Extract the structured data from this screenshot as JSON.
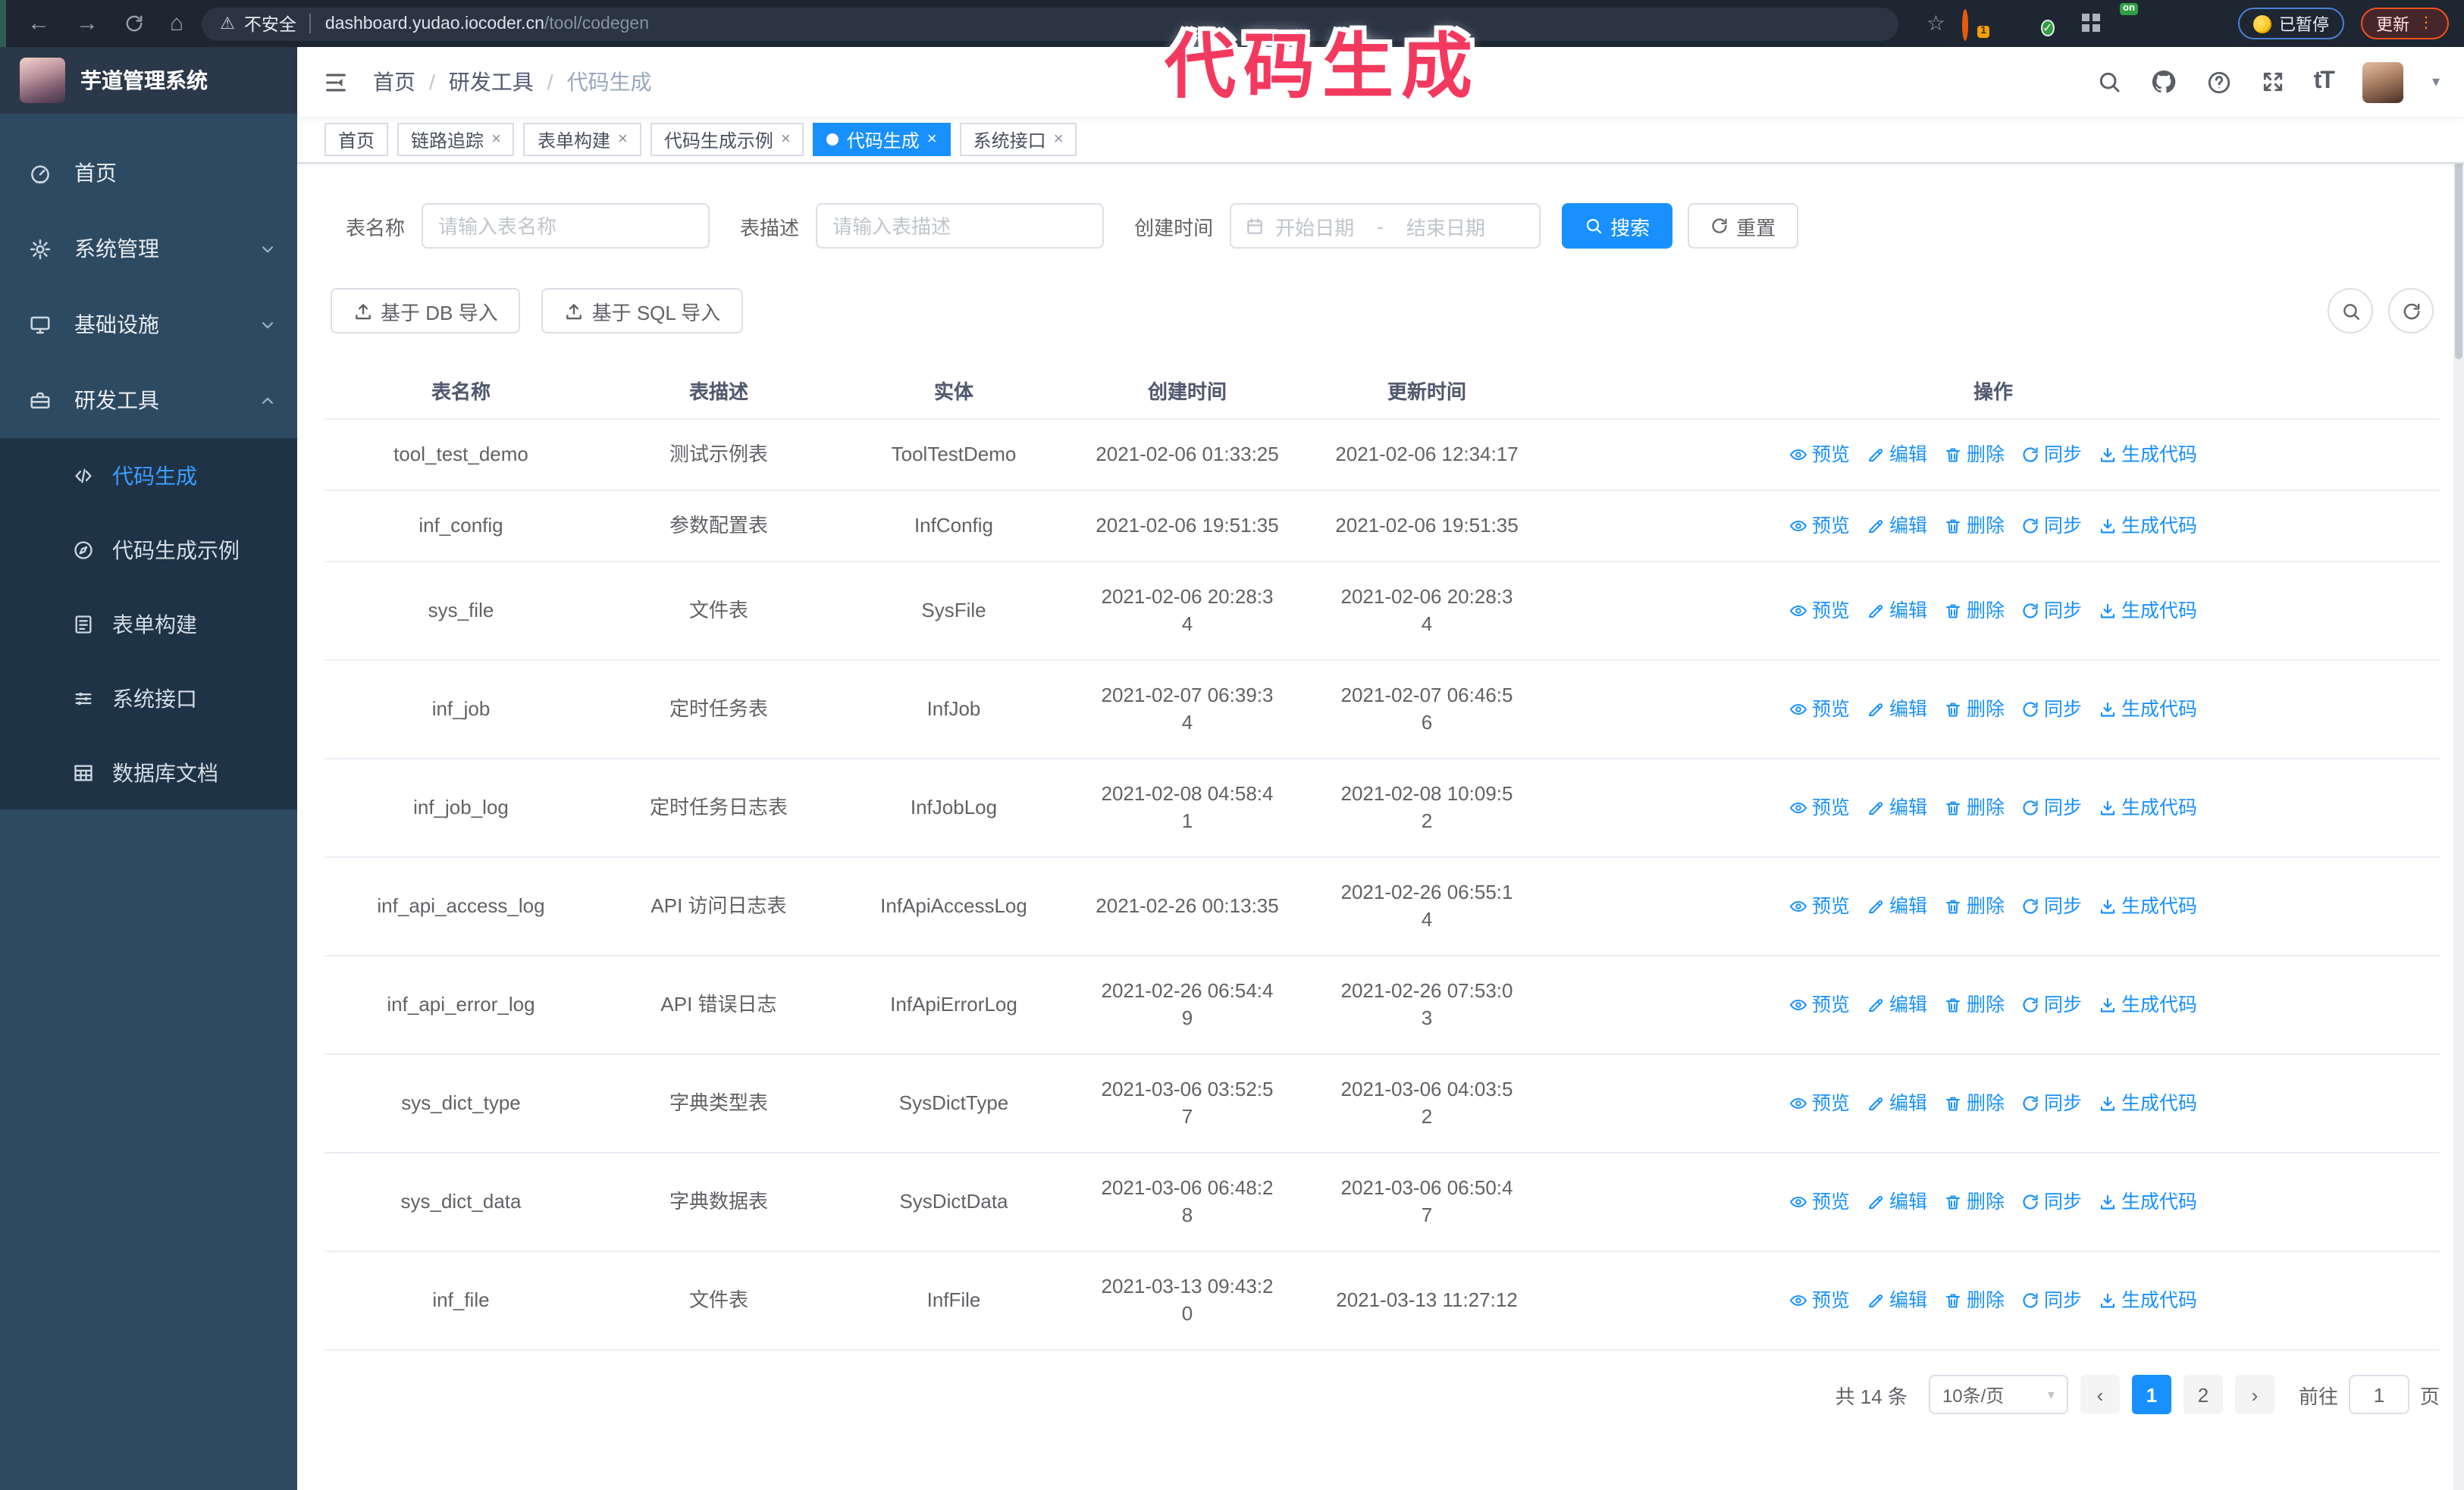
{
  "theme": {
    "primary": "#1890ff",
    "sidebar_bg": "#2d4a61",
    "submenu_bg": "#1e3346",
    "active_menu_text": "#3d9eff",
    "annotation_color": "#f4395f"
  },
  "browser": {
    "security_label": "不安全",
    "url_host": "dashboard.yudao.iocoder.cn",
    "url_path": "/tool/codegen",
    "paused_badge": "已暂停",
    "update_button": "更新"
  },
  "annotation": {
    "text": "代码生成"
  },
  "app": {
    "title": "芋道管理系统"
  },
  "sidebar": {
    "items": [
      {
        "label": "首页",
        "icon": "dashboard-icon",
        "chevron": null
      },
      {
        "label": "系统管理",
        "icon": "gear-icon",
        "chevron": "down"
      },
      {
        "label": "基础设施",
        "icon": "infrastructure-icon",
        "chevron": "down"
      },
      {
        "label": "研发工具",
        "icon": "tools-icon",
        "chevron": "up"
      }
    ],
    "subitems": [
      {
        "label": "代码生成",
        "icon": "code-icon",
        "active": true
      },
      {
        "label": "代码生成示例",
        "icon": "example-icon",
        "active": false
      },
      {
        "label": "表单构建",
        "icon": "form-icon",
        "active": false
      },
      {
        "label": "系统接口",
        "icon": "api-icon",
        "active": false
      },
      {
        "label": "数据库文档",
        "icon": "db-doc-icon",
        "active": false
      }
    ]
  },
  "breadcrumb": [
    "首页",
    "研发工具",
    "代码生成"
  ],
  "tabs": [
    {
      "label": "首页",
      "closable": false,
      "active": false
    },
    {
      "label": "链路追踪",
      "closable": true,
      "active": false
    },
    {
      "label": "表单构建",
      "closable": true,
      "active": false
    },
    {
      "label": "代码生成示例",
      "closable": true,
      "active": false
    },
    {
      "label": "代码生成",
      "closable": true,
      "active": true
    },
    {
      "label": "系统接口",
      "closable": true,
      "active": false
    }
  ],
  "filters": {
    "table_name_label": "表名称",
    "table_name_placeholder": "请输入表名称",
    "table_desc_label": "表描述",
    "table_desc_placeholder": "请输入表描述",
    "create_time_label": "创建时间",
    "date_start_placeholder": "开始日期",
    "date_separator": "-",
    "date_end_placeholder": "结束日期",
    "search_button": "搜索",
    "reset_button": "重置"
  },
  "toolbar": {
    "import_db_button": "基于 DB 导入",
    "import_sql_button": "基于 SQL 导入"
  },
  "table": {
    "columns": [
      "表名称",
      "表描述",
      "实体",
      "创建时间",
      "更新时间",
      "操作"
    ],
    "actions": [
      "预览",
      "编辑",
      "删除",
      "同步",
      "生成代码"
    ],
    "rows": [
      {
        "name": "tool_test_demo",
        "desc": "测试示例表",
        "entity": "ToolTestDemo",
        "created": "2021-02-06 01:33:25",
        "updated": "2021-02-06 12:34:17"
      },
      {
        "name": "inf_config",
        "desc": "参数配置表",
        "entity": "InfConfig",
        "created": "2021-02-06 19:51:35",
        "updated": "2021-02-06 19:51:35"
      },
      {
        "name": "sys_file",
        "desc": "文件表",
        "entity": "SysFile",
        "created": "2021-02-06 20:28:3\n4",
        "updated": "2021-02-06 20:28:3\n4"
      },
      {
        "name": "inf_job",
        "desc": "定时任务表",
        "entity": "InfJob",
        "created": "2021-02-07 06:39:3\n4",
        "updated": "2021-02-07 06:46:5\n6"
      },
      {
        "name": "inf_job_log",
        "desc": "定时任务日志表",
        "entity": "InfJobLog",
        "created": "2021-02-08 04:58:4\n1",
        "updated": "2021-02-08 10:09:5\n2"
      },
      {
        "name": "inf_api_access_log",
        "desc": "API 访问日志表",
        "entity": "InfApiAccessLog",
        "created": "2021-02-26 00:13:35",
        "updated": "2021-02-26 06:55:1\n4"
      },
      {
        "name": "inf_api_error_log",
        "desc": "API 错误日志",
        "entity": "InfApiErrorLog",
        "created": "2021-02-26 06:54:4\n9",
        "updated": "2021-02-26 07:53:0\n3"
      },
      {
        "name": "sys_dict_type",
        "desc": "字典类型表",
        "entity": "SysDictType",
        "created": "2021-03-06 03:52:5\n7",
        "updated": "2021-03-06 04:03:5\n2"
      },
      {
        "name": "sys_dict_data",
        "desc": "字典数据表",
        "entity": "SysDictData",
        "created": "2021-03-06 06:48:2\n8",
        "updated": "2021-03-06 06:50:4\n7"
      },
      {
        "name": "inf_file",
        "desc": "文件表",
        "entity": "InfFile",
        "created": "2021-03-13 09:43:2\n0",
        "updated": "2021-03-13 11:27:12"
      }
    ]
  },
  "pagination": {
    "total": "共 14 条",
    "page_size": "10条/页",
    "pages": [
      "1",
      "2"
    ],
    "active_page": "1",
    "prev": "‹",
    "next": "›",
    "goto_label": "前往",
    "goto_value": "1",
    "goto_unit": "页"
  }
}
